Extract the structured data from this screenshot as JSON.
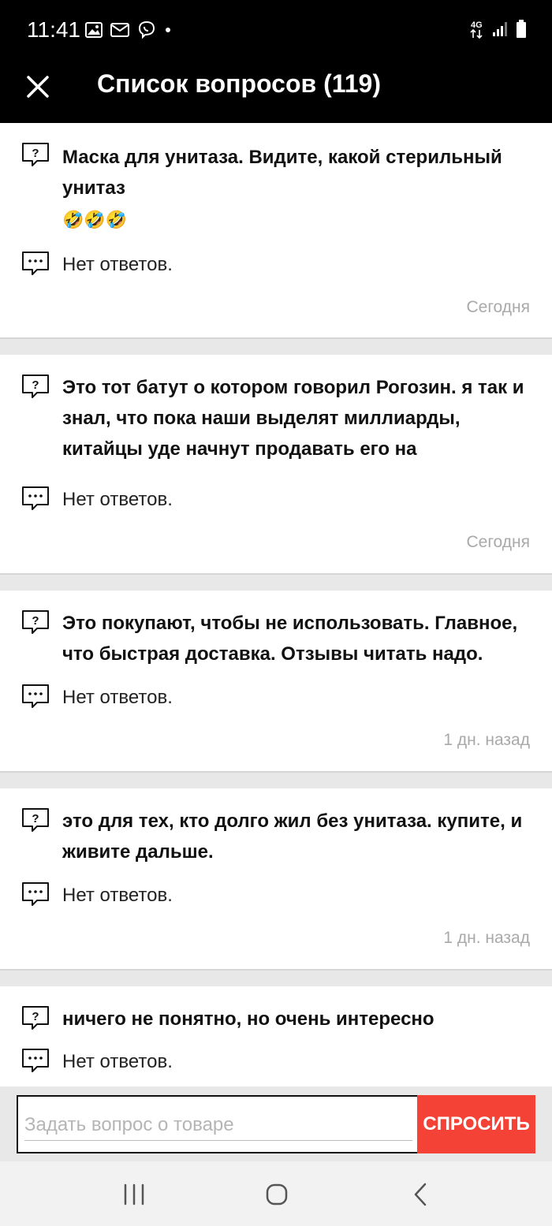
{
  "status_bar": {
    "time": "11:41",
    "network": "4G",
    "icons": [
      "image-icon",
      "mail-icon",
      "viber-icon",
      "dot-icon",
      "network-4g-icon",
      "signal-icon",
      "battery-icon"
    ]
  },
  "app_bar": {
    "title": "Список вопросов (119)",
    "close_icon": "close-icon"
  },
  "questions": [
    {
      "question": "Маска для унитаза. Видите, какой стерильный унитаз",
      "emoji": "🤣🤣🤣",
      "answer": "Нет ответов.",
      "date": "Сегодня"
    },
    {
      "question": "Это тот батут о котором говорил Рогозин. я так и знал,  что пока наши выделят миллиарды, китайцы уде начнут продавать его на",
      "answer": "Нет ответов.",
      "date": "Сегодня"
    },
    {
      "question": "Это покупают, чтобы не использовать. Главное, что быстрая доставка. Отзывы читать надо.",
      "answer": "Нет ответов.",
      "date": "1 дн. назад"
    },
    {
      "question": "это для тех, кто долго жил без унитаза. купите, и живите дальше.",
      "answer": "Нет ответов.",
      "date": "1 дн. назад"
    },
    {
      "question": "ничего не понятно, но очень интересно",
      "answer": "Нет ответов."
    }
  ],
  "ask_form": {
    "placeholder": "Задать вопрос о товаре",
    "value": "",
    "button_label": "СПРОСИТЬ",
    "button_color": "#f44336"
  },
  "nav_bar": {
    "icons": [
      "recent-apps-icon",
      "home-icon",
      "back-icon"
    ]
  }
}
